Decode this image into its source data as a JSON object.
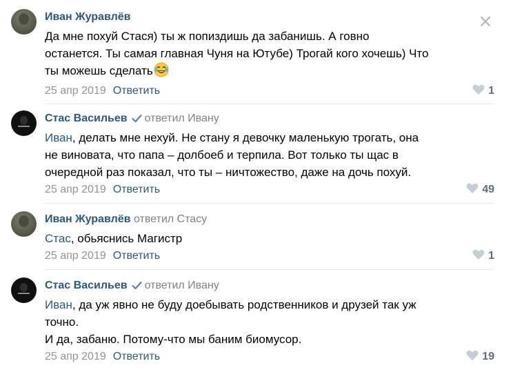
{
  "comments": [
    {
      "author": "Иван Журавлёв",
      "replied_to": "",
      "mention": "",
      "lines": [
        "Да мне похуй Стася) ты ж попиздишь да забанишь. А говно",
        "останется. Ты самая главная Чуня на Ютубе) Трогай кого хочешь) Что",
        "ты можешь сделать"
      ],
      "emoji": "face-with-tears-of-joy-icon",
      "date": "25 апр 2019",
      "reply_label": "Ответить",
      "likes": "1"
    },
    {
      "author": "Стас Васильев",
      "verified": true,
      "replied_to": "ответил Ивану",
      "mention": "Иван",
      "lines": [
        ", делать мне нехуй. Не стану я девочку маленькую трогать, она",
        "не виновата, что папа – долбоеб и терпила. Вот только ты щас в",
        "очередной раз показал, что ты – ничтожество, даже на дочь похуй."
      ],
      "date": "25 апр 2019",
      "reply_label": "Ответить",
      "likes": "49"
    },
    {
      "author": "Иван Журавлёв",
      "replied_to": "ответил Стасу",
      "mention": "Стас",
      "lines": [
        ", обьяснись Магистр"
      ],
      "date": "25 апр 2019",
      "reply_label": "Ответить",
      "likes": "1"
    },
    {
      "author": "Стас Васильев",
      "verified": true,
      "replied_to": "ответил Ивану",
      "mention": "Иван",
      "lines": [
        ", да уж явно не буду доебывать родственников и друзей так уж",
        "точно.",
        "И да, забаню. Потому-что мы баним биомусор."
      ],
      "date": "25 апр 2019",
      "reply_label": "Ответить",
      "likes": "19"
    }
  ],
  "colors": {
    "link": "#2a5885",
    "muted": "#939393",
    "likes": "#5f6c7d",
    "divider": "#e7e8ec"
  }
}
